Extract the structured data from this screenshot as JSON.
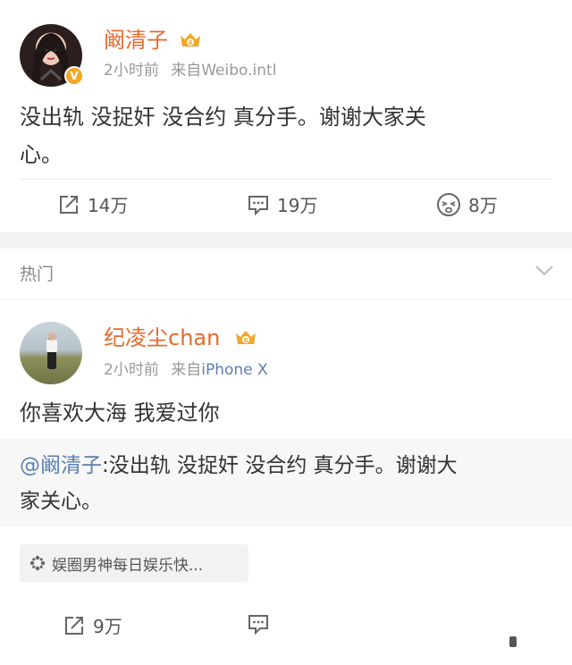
{
  "post1": {
    "username": "阚清子",
    "time": "2小时前",
    "source_prefix": "来自",
    "source": "Weibo.intl",
    "text_line1": "没出轨 没捉奸 没合约 真分手。谢谢大家关",
    "text_line2": "心。",
    "actions": {
      "repost": "14万",
      "comment": "19万",
      "like": "8万"
    },
    "verified_badge": "V"
  },
  "hot_section": {
    "label": "热门"
  },
  "post2": {
    "username": "纪凌尘chan",
    "time": "2小时前",
    "source_prefix": "来自",
    "source": "iPhone X",
    "text": "你喜欢大海 我爱过你",
    "repost": {
      "mention": "@阚清子",
      "text_line1": ":没出轨 没捉奸 没合约 真分手。谢谢大",
      "text_line2": "家关心。"
    },
    "topic_chip": "娱圈男神每日娱乐快...",
    "actions": {
      "repost": "9万"
    }
  },
  "colors": {
    "username": "#e8692b",
    "link": "#5a7fb3",
    "crown": "#f5a623"
  },
  "icons": [
    "crown-badge-icon",
    "repost-icon",
    "comment-icon",
    "like-face-icon",
    "chevron-down-icon",
    "topic-icon"
  ]
}
